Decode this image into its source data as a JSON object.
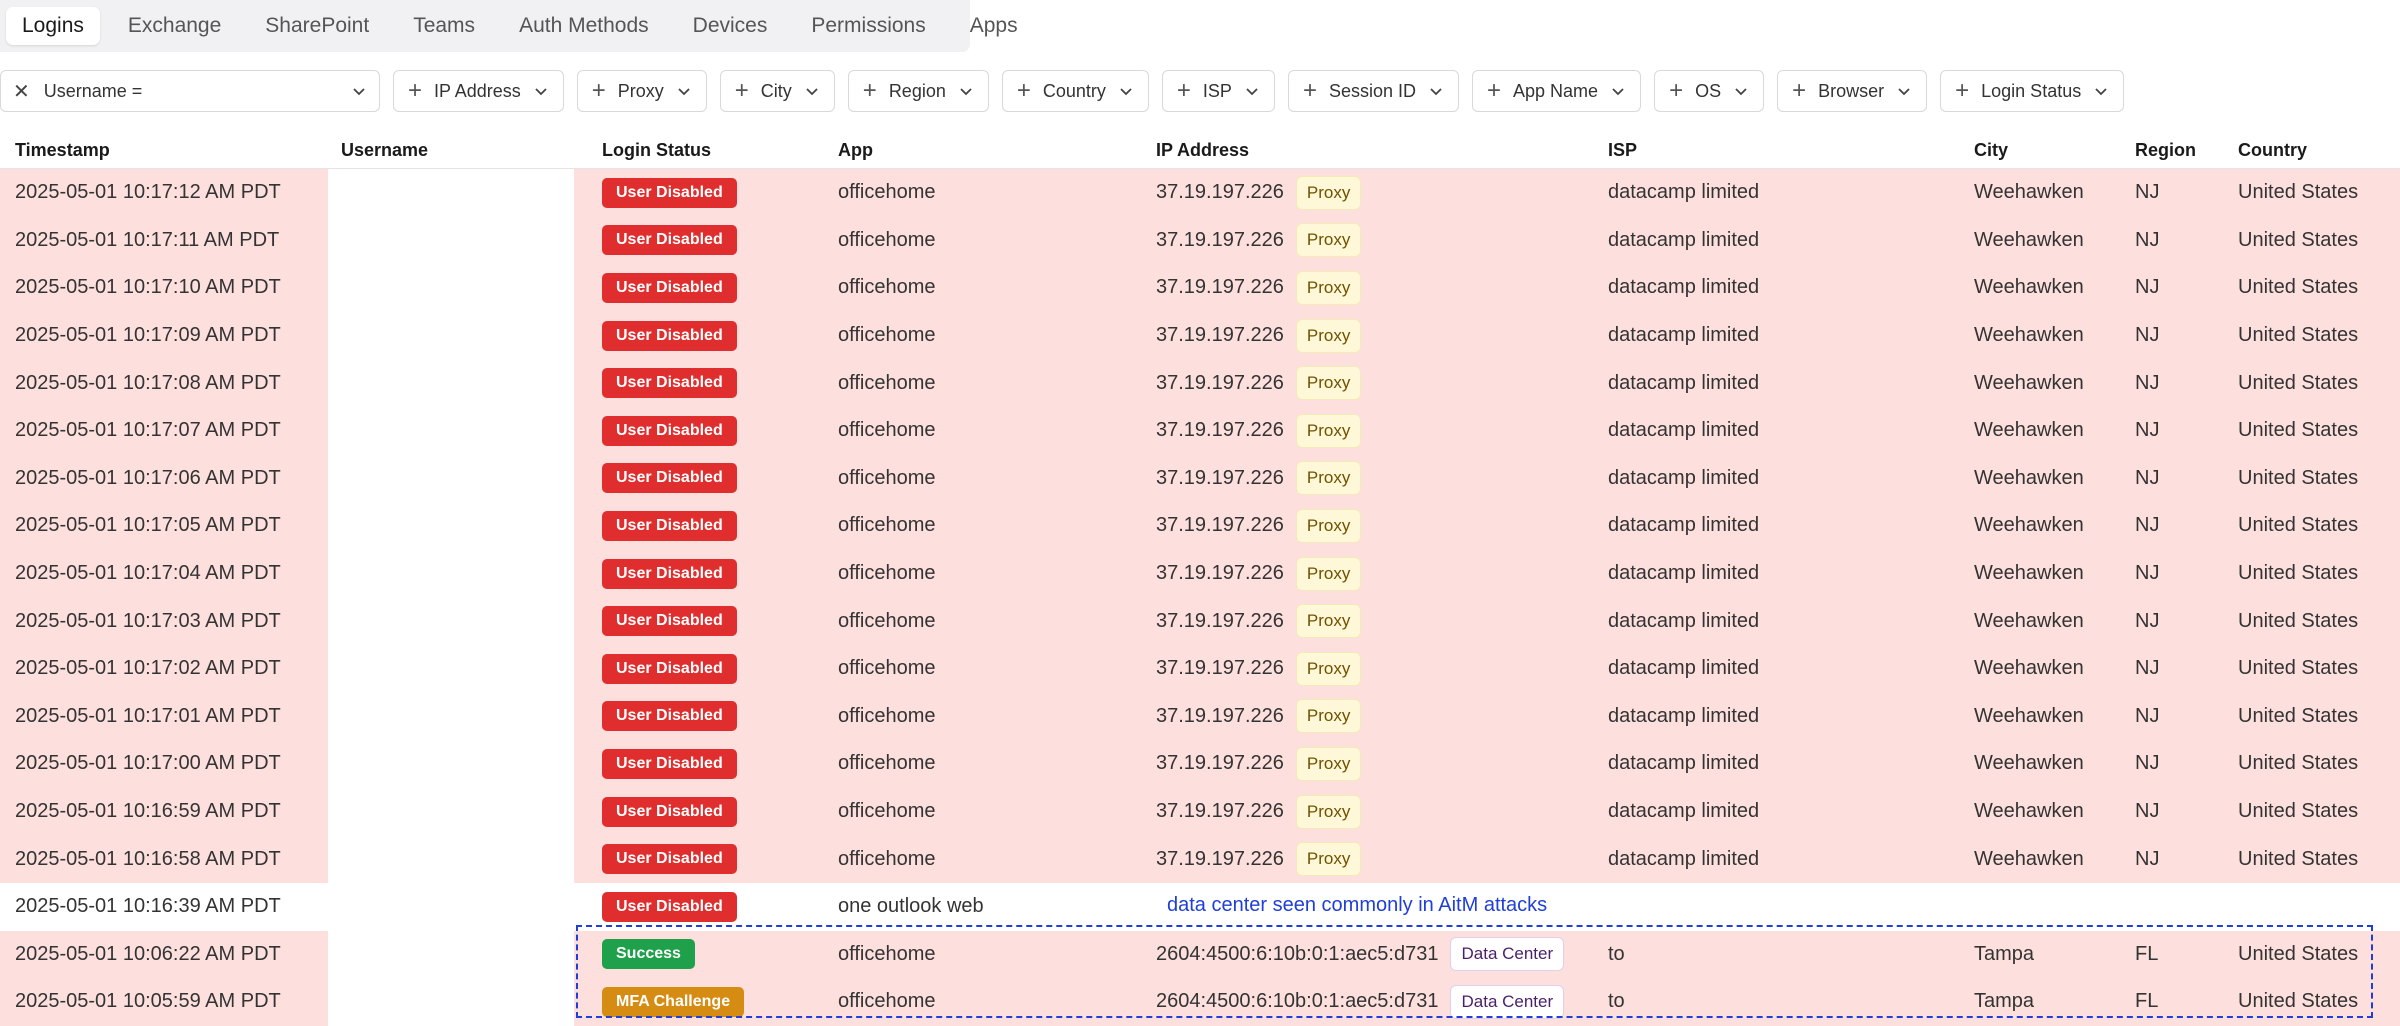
{
  "tabs": [
    {
      "label": "Logins",
      "active": true
    },
    {
      "label": "Exchange"
    },
    {
      "label": "SharePoint"
    },
    {
      "label": "Teams"
    },
    {
      "label": "Auth Methods"
    },
    {
      "label": "Devices"
    },
    {
      "label": "Permissions"
    },
    {
      "label": "Apps"
    }
  ],
  "filters": {
    "username_label": "Username =",
    "chips": [
      "IP Address",
      "Proxy",
      "City",
      "Region",
      "Country",
      "ISP",
      "Session ID",
      "App Name",
      "OS",
      "Browser",
      "Login Status"
    ]
  },
  "columns": {
    "timestamp": "Timestamp",
    "username": "Username",
    "status": "Login Status",
    "app": "App",
    "ip": "IP Address",
    "isp": "ISP",
    "city": "City",
    "region": "Region",
    "country": "Country"
  },
  "rows": [
    {
      "timestamp": "2025-05-01 10:17:12 AM PDT",
      "status": "User Disabled",
      "status_color": "red",
      "app": "officehome",
      "ip": "37.19.197.226",
      "ip_tag": "Proxy",
      "isp": "datacamp limited",
      "city": "Weehawken",
      "region": "NJ",
      "country": "United States"
    },
    {
      "timestamp": "2025-05-01 10:17:11 AM PDT",
      "status": "User Disabled",
      "status_color": "red",
      "app": "officehome",
      "ip": "37.19.197.226",
      "ip_tag": "Proxy",
      "isp": "datacamp limited",
      "city": "Weehawken",
      "region": "NJ",
      "country": "United States"
    },
    {
      "timestamp": "2025-05-01 10:17:10 AM PDT",
      "status": "User Disabled",
      "status_color": "red",
      "app": "officehome",
      "ip": "37.19.197.226",
      "ip_tag": "Proxy",
      "isp": "datacamp limited",
      "city": "Weehawken",
      "region": "NJ",
      "country": "United States"
    },
    {
      "timestamp": "2025-05-01 10:17:09 AM PDT",
      "status": "User Disabled",
      "status_color": "red",
      "app": "officehome",
      "ip": "37.19.197.226",
      "ip_tag": "Proxy",
      "isp": "datacamp limited",
      "city": "Weehawken",
      "region": "NJ",
      "country": "United States"
    },
    {
      "timestamp": "2025-05-01 10:17:08 AM PDT",
      "status": "User Disabled",
      "status_color": "red",
      "app": "officehome",
      "ip": "37.19.197.226",
      "ip_tag": "Proxy",
      "isp": "datacamp limited",
      "city": "Weehawken",
      "region": "NJ",
      "country": "United States"
    },
    {
      "timestamp": "2025-05-01 10:17:07 AM PDT",
      "status": "User Disabled",
      "status_color": "red",
      "app": "officehome",
      "ip": "37.19.197.226",
      "ip_tag": "Proxy",
      "isp": "datacamp limited",
      "city": "Weehawken",
      "region": "NJ",
      "country": "United States"
    },
    {
      "timestamp": "2025-05-01 10:17:06 AM PDT",
      "status": "User Disabled",
      "status_color": "red",
      "app": "officehome",
      "ip": "37.19.197.226",
      "ip_tag": "Proxy",
      "isp": "datacamp limited",
      "city": "Weehawken",
      "region": "NJ",
      "country": "United States"
    },
    {
      "timestamp": "2025-05-01 10:17:05 AM PDT",
      "status": "User Disabled",
      "status_color": "red",
      "app": "officehome",
      "ip": "37.19.197.226",
      "ip_tag": "Proxy",
      "isp": "datacamp limited",
      "city": "Weehawken",
      "region": "NJ",
      "country": "United States"
    },
    {
      "timestamp": "2025-05-01 10:17:04 AM PDT",
      "status": "User Disabled",
      "status_color": "red",
      "app": "officehome",
      "ip": "37.19.197.226",
      "ip_tag": "Proxy",
      "isp": "datacamp limited",
      "city": "Weehawken",
      "region": "NJ",
      "country": "United States"
    },
    {
      "timestamp": "2025-05-01 10:17:03 AM PDT",
      "status": "User Disabled",
      "status_color": "red",
      "app": "officehome",
      "ip": "37.19.197.226",
      "ip_tag": "Proxy",
      "isp": "datacamp limited",
      "city": "Weehawken",
      "region": "NJ",
      "country": "United States"
    },
    {
      "timestamp": "2025-05-01 10:17:02 AM PDT",
      "status": "User Disabled",
      "status_color": "red",
      "app": "officehome",
      "ip": "37.19.197.226",
      "ip_tag": "Proxy",
      "isp": "datacamp limited",
      "city": "Weehawken",
      "region": "NJ",
      "country": "United States"
    },
    {
      "timestamp": "2025-05-01 10:17:01 AM PDT",
      "status": "User Disabled",
      "status_color": "red",
      "app": "officehome",
      "ip": "37.19.197.226",
      "ip_tag": "Proxy",
      "isp": "datacamp limited",
      "city": "Weehawken",
      "region": "NJ",
      "country": "United States"
    },
    {
      "timestamp": "2025-05-01 10:17:00 AM PDT",
      "status": "User Disabled",
      "status_color": "red",
      "app": "officehome",
      "ip": "37.19.197.226",
      "ip_tag": "Proxy",
      "isp": "datacamp limited",
      "city": "Weehawken",
      "region": "NJ",
      "country": "United States"
    },
    {
      "timestamp": "2025-05-01 10:16:59 AM PDT",
      "status": "User Disabled",
      "status_color": "red",
      "app": "officehome",
      "ip": "37.19.197.226",
      "ip_tag": "Proxy",
      "isp": "datacamp limited",
      "city": "Weehawken",
      "region": "NJ",
      "country": "United States"
    },
    {
      "timestamp": "2025-05-01 10:16:58 AM PDT",
      "status": "User Disabled",
      "status_color": "red",
      "app": "officehome",
      "ip": "37.19.197.226",
      "ip_tag": "Proxy",
      "isp": "datacamp limited",
      "city": "Weehawken",
      "region": "NJ",
      "country": "United States"
    },
    {
      "timestamp": "2025-05-01 10:16:39 AM PDT",
      "status": "User Disabled",
      "status_color": "red",
      "app": "one outlook web",
      "ip": "",
      "ip_tag": "",
      "isp": "",
      "city": "",
      "region": "",
      "country": "",
      "row_bg": "white"
    },
    {
      "timestamp": "2025-05-01 10:06:22 AM PDT",
      "status": "Success",
      "status_color": "green",
      "app": "officehome",
      "ip": "2604:4500:6:10b:0:1:aec5:d731",
      "ip_tag": "Data Center",
      "isp": "to",
      "city": "Tampa",
      "region": "FL",
      "country": "United States"
    },
    {
      "timestamp": "2025-05-01 10:05:59 AM PDT",
      "status": "MFA Challenge",
      "status_color": "orange",
      "app": "officehome",
      "ip": "2604:4500:6:10b:0:1:aec5:d731",
      "ip_tag": "Data Center",
      "isp": "to",
      "city": "Tampa",
      "region": "FL",
      "country": "United States"
    }
  ],
  "annotation": {
    "text": "data center seen commonly in AitM attacks",
    "color": "#1f3fd6"
  },
  "colors": {
    "row_highlight": "#fde0de",
    "badge_red": "#e02d2d",
    "badge_green": "#1fa04a",
    "badge_orange": "#d68b12"
  }
}
